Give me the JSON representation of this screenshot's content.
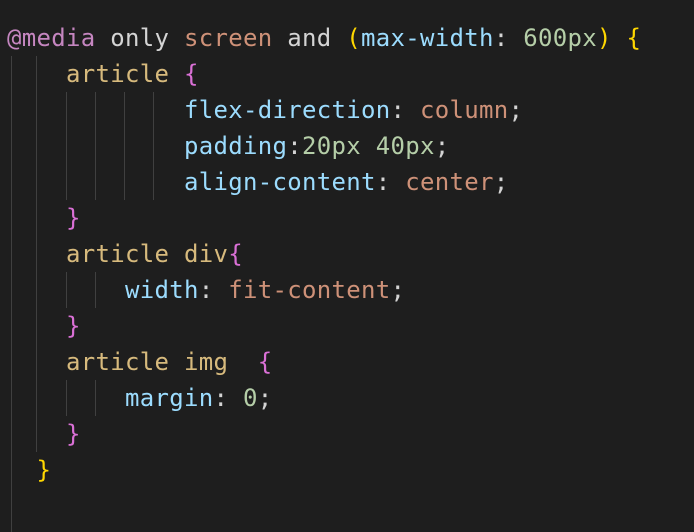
{
  "editor": {
    "lines": [
      {
        "tokens": [
          {
            "t": "@media",
            "c": "at"
          },
          {
            "t": " ",
            "c": "punc"
          },
          {
            "t": "only",
            "c": "kw"
          },
          {
            "t": " ",
            "c": "punc"
          },
          {
            "t": "screen",
            "c": "val"
          },
          {
            "t": " ",
            "c": "punc"
          },
          {
            "t": "and",
            "c": "kw"
          },
          {
            "t": " ",
            "c": "punc"
          },
          {
            "t": "(",
            "c": "b1"
          },
          {
            "t": "max-width",
            "c": "prop"
          },
          {
            "t": ": ",
            "c": "punc"
          },
          {
            "t": "600px",
            "c": "num"
          },
          {
            "t": ")",
            "c": "b1"
          },
          {
            "t": " ",
            "c": "punc"
          },
          {
            "t": "{",
            "c": "b1"
          }
        ]
      },
      {
        "tokens": [
          {
            "t": "    ",
            "c": "punc"
          },
          {
            "t": "article",
            "c": "sel"
          },
          {
            "t": " ",
            "c": "punc"
          },
          {
            "t": "{",
            "c": "b2"
          }
        ]
      },
      {
        "tokens": [
          {
            "t": "            ",
            "c": "punc"
          },
          {
            "t": "flex-direction",
            "c": "prop"
          },
          {
            "t": ": ",
            "c": "punc"
          },
          {
            "t": "column",
            "c": "val"
          },
          {
            "t": ";",
            "c": "punc"
          }
        ]
      },
      {
        "tokens": [
          {
            "t": "            ",
            "c": "punc"
          },
          {
            "t": "padding",
            "c": "prop"
          },
          {
            "t": ":",
            "c": "punc"
          },
          {
            "t": "20px",
            "c": "num"
          },
          {
            "t": " ",
            "c": "punc"
          },
          {
            "t": "40px",
            "c": "num"
          },
          {
            "t": ";",
            "c": "punc"
          }
        ]
      },
      {
        "tokens": [
          {
            "t": "            ",
            "c": "punc"
          },
          {
            "t": "align-content",
            "c": "prop"
          },
          {
            "t": ": ",
            "c": "punc"
          },
          {
            "t": "center",
            "c": "val"
          },
          {
            "t": ";",
            "c": "punc"
          }
        ]
      },
      {
        "tokens": [
          {
            "t": "    ",
            "c": "punc"
          },
          {
            "t": "}",
            "c": "b2"
          }
        ]
      },
      {
        "tokens": [
          {
            "t": "    ",
            "c": "punc"
          },
          {
            "t": "article div",
            "c": "sel"
          },
          {
            "t": "{",
            "c": "b2"
          }
        ]
      },
      {
        "tokens": [
          {
            "t": "        ",
            "c": "punc"
          },
          {
            "t": "width",
            "c": "prop"
          },
          {
            "t": ": ",
            "c": "punc"
          },
          {
            "t": "fit-content",
            "c": "val"
          },
          {
            "t": ";",
            "c": "punc"
          }
        ]
      },
      {
        "tokens": [
          {
            "t": "    ",
            "c": "punc"
          },
          {
            "t": "}",
            "c": "b2"
          }
        ]
      },
      {
        "tokens": [
          {
            "t": "    ",
            "c": "punc"
          },
          {
            "t": "article img",
            "c": "sel"
          },
          {
            "t": "  ",
            "c": "punc"
          },
          {
            "t": "{",
            "c": "b2"
          }
        ]
      },
      {
        "tokens": [
          {
            "t": "        ",
            "c": "punc"
          },
          {
            "t": "margin",
            "c": "prop"
          },
          {
            "t": ": ",
            "c": "punc"
          },
          {
            "t": "0",
            "c": "num"
          },
          {
            "t": ";",
            "c": "punc"
          }
        ]
      },
      {
        "tokens": [
          {
            "t": "    ",
            "c": "punc"
          },
          {
            "t": "}",
            "c": "b2"
          }
        ]
      },
      {
        "tokens": [
          {
            "t": "  ",
            "c": "punc"
          },
          {
            "t": "}",
            "c": "b1"
          }
        ]
      }
    ]
  },
  "colors": {
    "background": "#1e1e1e",
    "at_rule": "#c586c0",
    "keyword": "#d4d4d4",
    "value": "#ce9178",
    "property": "#9cdcfe",
    "number": "#b5cea8",
    "selector": "#d7ba7d",
    "bracket_level1": "#ffd700",
    "bracket_level2": "#da70d6",
    "indent_guide": "#404040"
  }
}
